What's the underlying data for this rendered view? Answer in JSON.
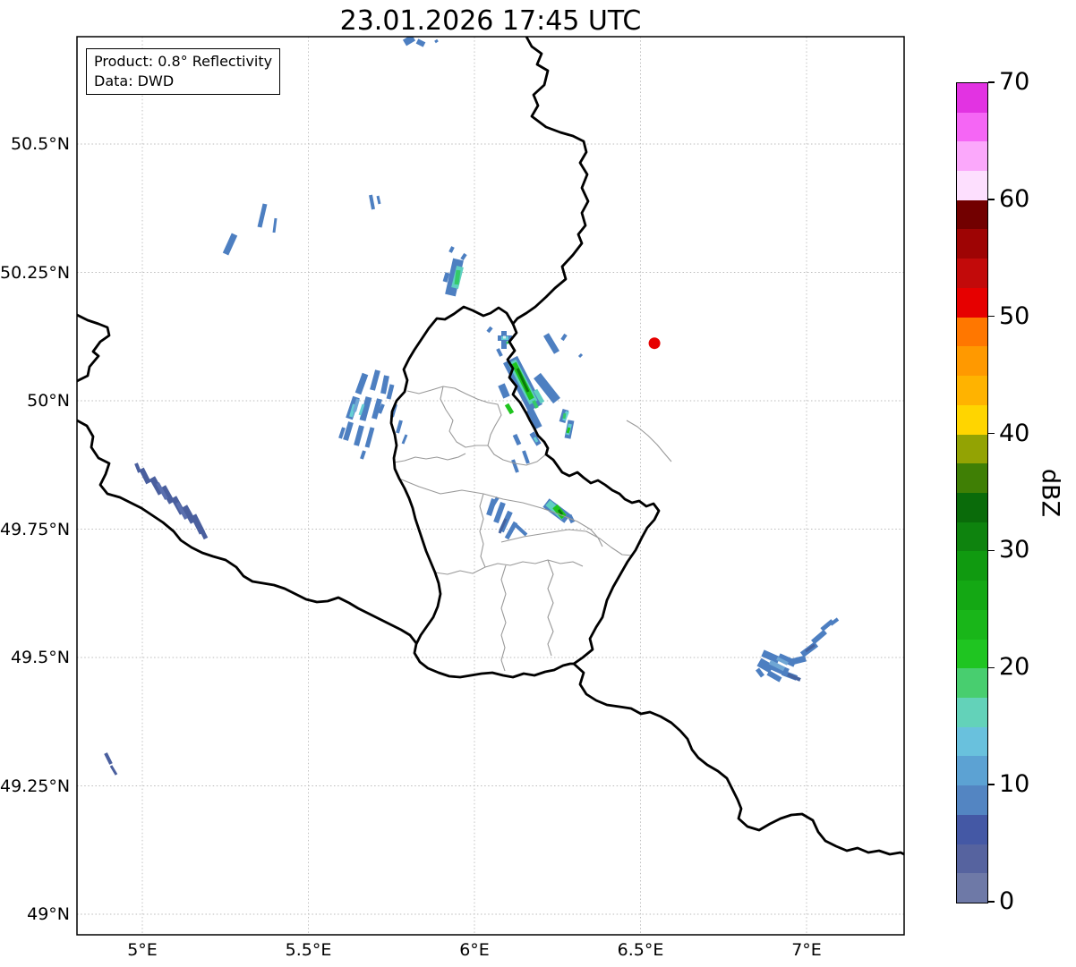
{
  "title": "23.01.2026 17:45 UTC",
  "info_box": {
    "line1": "Product: 0.8° Reflectivity",
    "line2": "Data: DWD"
  },
  "map": {
    "lon_ticks": [
      {
        "value": 5.0,
        "label": "5°E"
      },
      {
        "value": 5.5,
        "label": "5.5°E"
      },
      {
        "value": 6.0,
        "label": "6°E"
      },
      {
        "value": 6.5,
        "label": "6.5°E"
      },
      {
        "value": 7.0,
        "label": "7°E"
      }
    ],
    "lat_ticks": [
      {
        "value": 50.5,
        "label": "50.5°N"
      },
      {
        "value": 50.25,
        "label": "50.25°N"
      },
      {
        "value": 50.0,
        "label": "50°N"
      },
      {
        "value": 49.75,
        "label": "49.75°N"
      },
      {
        "value": 49.5,
        "label": "49.5°N"
      },
      {
        "value": 49.25,
        "label": "49.25°N"
      },
      {
        "value": 49.0,
        "label": "49°N"
      }
    ],
    "radar_site_marker": {
      "lon": 6.542,
      "lat": 50.112,
      "color": "#e60000"
    }
  },
  "colorbar": {
    "label": "dBZ",
    "min": 0,
    "max": 70,
    "step": 2.5,
    "tick_values": [
      0,
      10,
      20,
      30,
      40,
      50,
      60,
      70
    ],
    "colors": [
      "#6E79A7",
      "#56639F",
      "#4458A5",
      "#5385C2",
      "#5CA2D3",
      "#69C1DD",
      "#63D2B9",
      "#48CE6F",
      "#1FC521",
      "#19B619",
      "#14A814",
      "#109A10",
      "#0E830E",
      "#0A6B0A",
      "#3F7F05",
      "#93A303",
      "#FFD500",
      "#FFB300",
      "#FF9900",
      "#FF7700",
      "#E60000",
      "#C20A0A",
      "#9E0404",
      "#720000",
      "#FDDFFE",
      "#FBA8FB",
      "#F566F5",
      "#E233E2"
    ]
  },
  "palette": {
    "b": "#4d7fc1",
    "s": "#4a5f9e",
    "l": "#5a6fae",
    "m": "#45639f",
    "L": "#6fa6d4",
    "t": "#5fcfc0",
    "c": "#66cfd4",
    "sg": "#35c96a",
    "g": "#1fc41e",
    "G": "#0a7a0a",
    "w": "#d8f0f0"
  },
  "chart_data": {
    "type": "heatmap",
    "title": "23.01.2026 17:45 UTC",
    "product": "0.8° Reflectivity",
    "source": "DWD",
    "units": "dBZ",
    "colorbar_range": [
      0,
      70
    ],
    "extent": {
      "lon_min": 4.8,
      "lon_max": 7.29,
      "lat_min": 48.96,
      "lat_max": 50.71
    },
    "radar_site": {
      "lon": 6.542,
      "lat": 50.112
    },
    "cells": [
      {
        "lon": 5.81,
        "lat": 50.7,
        "max_dbz": 8
      },
      {
        "lon": 5.26,
        "lat": 50.3,
        "max_dbz": 6
      },
      {
        "lon": 5.36,
        "lat": 50.36,
        "max_dbz": 6
      },
      {
        "lon": 5.7,
        "lat": 50.39,
        "max_dbz": 6
      },
      {
        "lon": 5.94,
        "lat": 50.25,
        "max_dbz": 22
      },
      {
        "lon": 6.09,
        "lat": 50.12,
        "max_dbz": 18
      },
      {
        "lon": 6.14,
        "lat": 50.03,
        "max_dbz": 34
      },
      {
        "lon": 6.28,
        "lat": 49.96,
        "max_dbz": 24
      },
      {
        "lon": 5.67,
        "lat": 49.98,
        "max_dbz": 14
      },
      {
        "lon": 5.09,
        "lat": 49.81,
        "max_dbz": 5
      },
      {
        "lon": 6.08,
        "lat": 49.77,
        "max_dbz": 10
      },
      {
        "lon": 6.25,
        "lat": 49.79,
        "max_dbz": 32
      },
      {
        "lon": 6.96,
        "lat": 49.51,
        "max_dbz": 10
      },
      {
        "lon": 4.9,
        "lat": 49.3,
        "max_dbz": 4
      }
    ],
    "echo_segments": [
      [
        "b",
        452,
        48,
        462,
        42,
        8
      ],
      [
        "b",
        466,
        46,
        474,
        50,
        6
      ],
      [
        "b",
        486,
        47,
        489,
        45,
        3
      ],
      [
        "b",
        252,
        284,
        262,
        262,
        7
      ],
      [
        "b",
        290,
        254,
        296,
        228,
        5
      ],
      [
        "b",
        306,
        260,
        308,
        244,
        3
      ],
      [
        "b",
        417,
        234,
        414,
        218,
        4
      ],
      [
        "b",
        424,
        228,
        422,
        219,
        3
      ],
      [
        "b",
        503,
        330,
        512,
        290,
        12
      ],
      [
        "t",
        508,
        322,
        514,
        298,
        8
      ],
      [
        "sg",
        510,
        318,
        512,
        302,
        5
      ],
      [
        "b",
        497,
        315,
        500,
        305,
        5
      ],
      [
        "b",
        503,
        282,
        506,
        276,
        4
      ],
      [
        "b",
        516,
        290,
        520,
        284,
        4
      ],
      [
        "b",
        556,
        378,
        572,
        378,
        6
      ],
      [
        "b",
        563,
        370,
        563,
        390,
        6
      ],
      [
        "c",
        560,
        378,
        568,
        378,
        4
      ],
      [
        "w",
        562,
        377,
        565,
        377,
        3
      ],
      [
        "sg",
        566,
        382,
        568,
        384,
        3
      ],
      [
        "b",
        556,
        390,
        560,
        398,
        4
      ],
      [
        "b",
        545,
        371,
        549,
        366,
        4
      ],
      [
        "b",
        570,
        402,
        598,
        456,
        18
      ],
      [
        "b",
        600,
        420,
        622,
        448,
        10
      ],
      [
        "b",
        610,
        374,
        622,
        394,
        7
      ],
      [
        "b",
        628,
        380,
        632,
        374,
        4
      ],
      [
        "b",
        647,
        399,
        650,
        396,
        3
      ],
      [
        "b",
        560,
        430,
        566,
        444,
        8
      ],
      [
        "b",
        592,
        458,
        602,
        478,
        8
      ],
      [
        "b",
        575,
        486,
        580,
        497,
        5
      ],
      [
        "t",
        572,
        404,
        596,
        450,
        10
      ],
      [
        "t",
        598,
        436,
        606,
        450,
        5
      ],
      [
        "g",
        574,
        406,
        594,
        446,
        6
      ],
      [
        "g",
        566,
        452,
        572,
        462,
        5
      ],
      [
        "sg",
        596,
        448,
        600,
        456,
        4
      ],
      [
        "G",
        578,
        412,
        590,
        438,
        3
      ],
      [
        "b",
        632,
        458,
        628,
        472,
        7
      ],
      [
        "b",
        638,
        470,
        634,
        490,
        7
      ],
      [
        "c",
        634,
        460,
        630,
        470,
        4
      ],
      [
        "c",
        637,
        474,
        634,
        486,
        4
      ],
      [
        "g",
        636,
        478,
        634,
        484,
        3
      ],
      [
        "sg",
        631,
        462,
        630,
        468,
        3
      ],
      [
        "b",
        594,
        484,
        602,
        497,
        6
      ],
      [
        "c",
        597,
        489,
        600,
        494,
        3
      ],
      [
        "b",
        585,
        504,
        590,
        518,
        4
      ],
      [
        "b",
        573,
        514,
        578,
        528,
        4
      ],
      [
        "b",
        408,
        418,
        400,
        440,
        7
      ],
      [
        "b",
        422,
        414,
        416,
        436,
        6
      ],
      [
        "b",
        432,
        420,
        428,
        440,
        6
      ],
      [
        "b",
        398,
        444,
        390,
        468,
        8
      ],
      [
        "b",
        412,
        444,
        405,
        470,
        7
      ],
      [
        "b",
        424,
        446,
        418,
        468,
        6
      ],
      [
        "b",
        392,
        472,
        386,
        492,
        6
      ],
      [
        "b",
        404,
        476,
        398,
        498,
        6
      ],
      [
        "b",
        416,
        478,
        410,
        500,
        5
      ],
      [
        "b",
        428,
        452,
        424,
        462,
        4
      ],
      [
        "b",
        438,
        430,
        434,
        446,
        5
      ],
      [
        "b",
        442,
        452,
        438,
        466,
        4
      ],
      [
        "b",
        407,
        504,
        404,
        513,
        4
      ],
      [
        "b",
        384,
        478,
        380,
        490,
        4
      ],
      [
        "c",
        396,
        452,
        392,
        466,
        4
      ],
      [
        "c",
        406,
        452,
        402,
        464,
        3
      ],
      [
        "L",
        400,
        446,
        396,
        460,
        4
      ],
      [
        "b",
        448,
        470,
        444,
        484,
        4
      ],
      [
        "b",
        454,
        486,
        450,
        496,
        3
      ],
      [
        "s",
        158,
        524,
        166,
        540,
        6
      ],
      [
        "s",
        170,
        534,
        180,
        552,
        7
      ],
      [
        "s",
        182,
        544,
        192,
        562,
        7
      ],
      [
        "s",
        194,
        556,
        204,
        574,
        7
      ],
      [
        "s",
        206,
        566,
        216,
        584,
        7
      ],
      [
        "s",
        216,
        576,
        226,
        596,
        7
      ],
      [
        "s",
        224,
        590,
        230,
        602,
        5
      ],
      [
        "s",
        152,
        518,
        156,
        528,
        4
      ],
      [
        "l",
        176,
        540,
        186,
        558,
        4
      ],
      [
        "l",
        198,
        562,
        208,
        580,
        4
      ],
      [
        "b",
        552,
        558,
        546,
        576,
        6
      ],
      [
        "b",
        562,
        562,
        554,
        584,
        6
      ],
      [
        "b",
        570,
        572,
        560,
        594,
        6
      ],
      [
        "b",
        576,
        584,
        566,
        602,
        5
      ],
      [
        "b",
        556,
        556,
        550,
        566,
        4
      ],
      [
        "m",
        565,
        580,
        558,
        596,
        3
      ],
      [
        "b",
        610,
        562,
        634,
        580,
        12
      ],
      [
        "t",
        612,
        562,
        630,
        578,
        8
      ],
      [
        "g",
        620,
        566,
        630,
        578,
        7
      ],
      [
        "G",
        624,
        570,
        628,
        575,
        3
      ],
      [
        "b",
        636,
        576,
        640,
        584,
        5
      ],
      [
        "b",
        576,
        587,
        588,
        598,
        4
      ],
      [
        "b",
        848,
        740,
        862,
        748,
        10
      ],
      [
        "b",
        862,
        744,
        880,
        752,
        9
      ],
      [
        "b",
        852,
        730,
        870,
        738,
        8
      ],
      [
        "b",
        870,
        734,
        888,
        742,
        8
      ],
      [
        "b",
        884,
        740,
        900,
        736,
        7
      ],
      [
        "b",
        896,
        732,
        912,
        720,
        7
      ],
      [
        "b",
        908,
        718,
        922,
        706,
        6
      ],
      [
        "b",
        918,
        704,
        930,
        694,
        5
      ],
      [
        "b",
        874,
        752,
        890,
        758,
        6
      ],
      [
        "b",
        858,
        752,
        872,
        760,
        6
      ],
      [
        "b",
        846,
        748,
        852,
        756,
        5
      ],
      [
        "L",
        860,
        740,
        876,
        748,
        5
      ],
      [
        "L",
        868,
        736,
        880,
        742,
        4
      ],
      [
        "m",
        880,
        754,
        894,
        760,
        4
      ],
      [
        "m",
        900,
        728,
        910,
        721,
        3
      ],
      [
        "b",
        928,
        698,
        936,
        692,
        4
      ],
      [
        "s",
        118,
        842,
        124,
        854,
        4
      ],
      [
        "s",
        124,
        856,
        130,
        866,
        3
      ]
    ]
  }
}
